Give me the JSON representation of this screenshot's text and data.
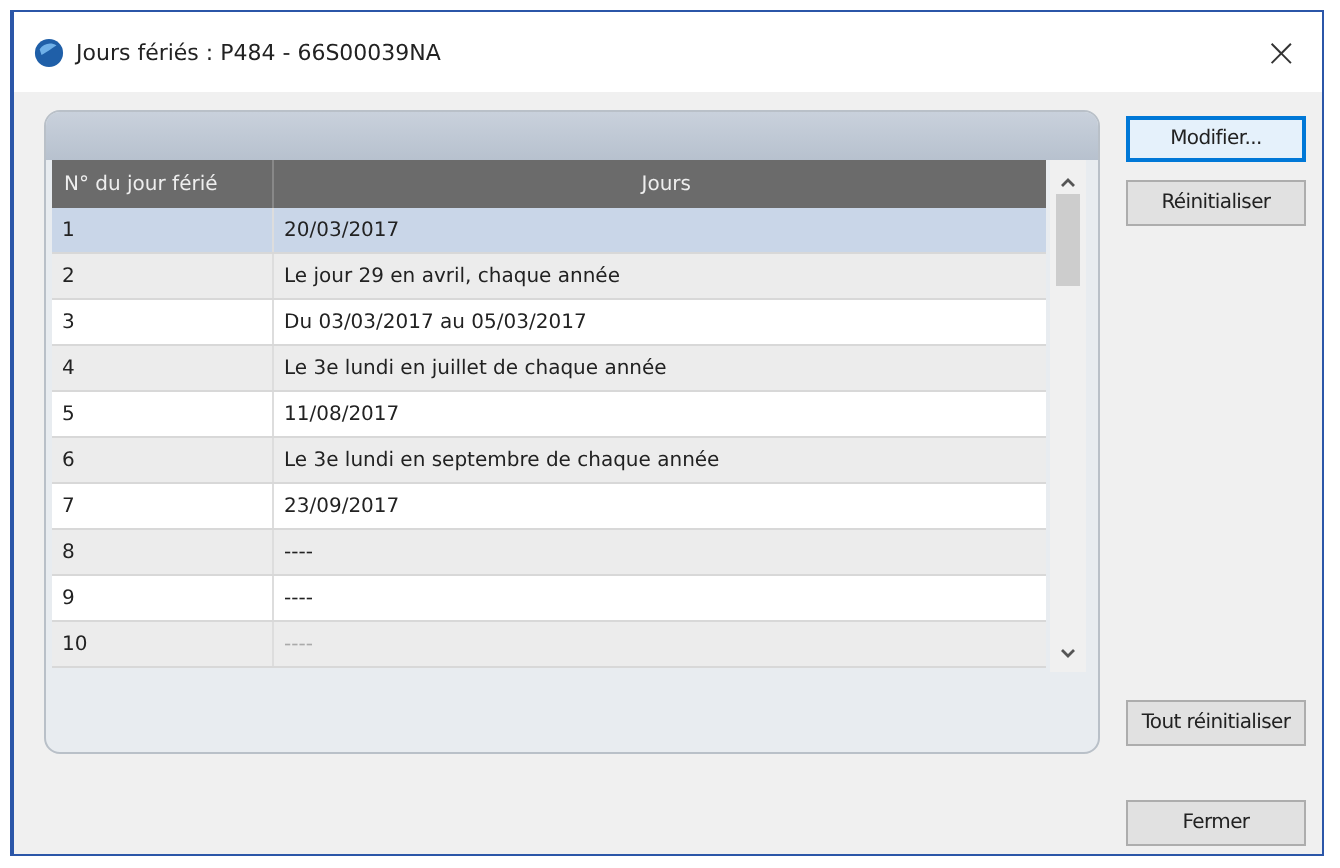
{
  "window": {
    "title": "Jours fériés : P484 - 66S00039NA",
    "close": "×"
  },
  "table": {
    "columns": [
      "N° du jour férié",
      "Jours"
    ],
    "rows": [
      {
        "cells": [
          "1",
          "20/03/2017"
        ],
        "selected": true,
        "disabled": false
      },
      {
        "cells": [
          "2",
          "Le jour 29 en avril, chaque année"
        ],
        "selected": false,
        "disabled": false
      },
      {
        "cells": [
          "3",
          "Du 03/03/2017 au 05/03/2017"
        ],
        "selected": false,
        "disabled": false
      },
      {
        "cells": [
          "4",
          "Le 3e lundi en juillet de chaque année"
        ],
        "selected": false,
        "disabled": false
      },
      {
        "cells": [
          "5",
          "11/08/2017"
        ],
        "selected": false,
        "disabled": false
      },
      {
        "cells": [
          "6",
          "Le 3e lundi en septembre de chaque année"
        ],
        "selected": false,
        "disabled": false
      },
      {
        "cells": [
          "7",
          "23/09/2017"
        ],
        "selected": false,
        "disabled": false
      },
      {
        "cells": [
          "8",
          "----"
        ],
        "selected": false,
        "disabled": false
      },
      {
        "cells": [
          "9",
          "----"
        ],
        "selected": false,
        "disabled": false
      },
      {
        "cells": [
          "10",
          "----"
        ],
        "selected": false,
        "disabled": true
      }
    ]
  },
  "buttons": [
    {
      "label": "Modifier...",
      "focused": true
    },
    {
      "label": "Réinitialiser",
      "focused": false
    },
    {
      "label": "Tout réinitialiser",
      "focused": false
    },
    {
      "label": "Fermer",
      "focused": false
    }
  ]
}
